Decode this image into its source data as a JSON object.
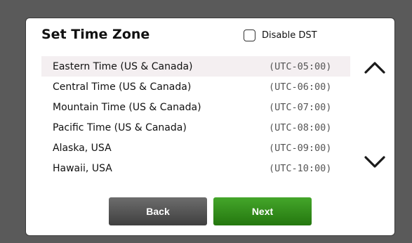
{
  "dialog": {
    "title": "Set Time Zone",
    "disable_dst": {
      "label": "Disable DST",
      "checked": false
    }
  },
  "timezones": [
    {
      "name": "Eastern Time (US & Canada)",
      "offset": "(UTC-05:00)",
      "selected": true
    },
    {
      "name": "Central Time (US & Canada)",
      "offset": "(UTC-06:00)",
      "selected": false
    },
    {
      "name": "Mountain Time (US & Canada)",
      "offset": "(UTC-07:00)",
      "selected": false
    },
    {
      "name": "Pacific Time (US & Canada)",
      "offset": "(UTC-08:00)",
      "selected": false
    },
    {
      "name": "Alaska, USA",
      "offset": "(UTC-09:00)",
      "selected": false
    },
    {
      "name": "Hawaii, USA",
      "offset": "(UTC-10:00)",
      "selected": false
    }
  ],
  "scroll": {
    "up_icon": "chevron-up-icon",
    "down_icon": "chevron-down-icon"
  },
  "buttons": {
    "back_label": "Back",
    "next_label": "Next"
  },
  "colors": {
    "background": "#5a5a5a",
    "selected_row": "#f4eff1",
    "back_button": "#4f4f4f",
    "next_button": "#2f8a1a"
  }
}
